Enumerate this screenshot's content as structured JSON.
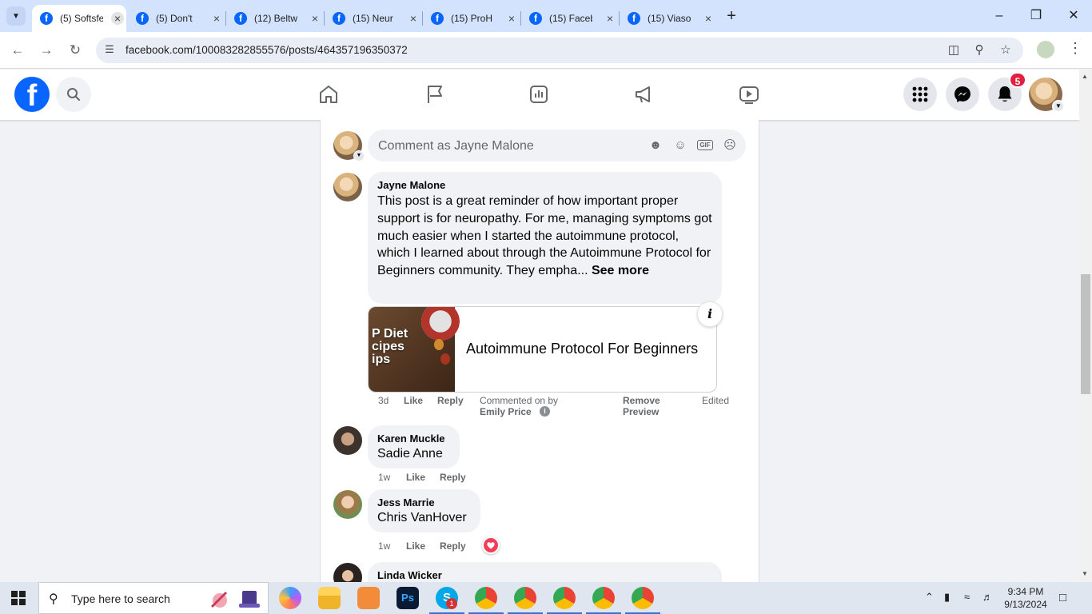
{
  "browser": {
    "tabs": [
      {
        "title": "(5) Softsfe",
        "active": true
      },
      {
        "title": "(5) Don't",
        "active": false
      },
      {
        "title": "(12) Beltw",
        "active": false
      },
      {
        "title": "(15) Neur",
        "active": false
      },
      {
        "title": "(15) ProH",
        "active": false
      },
      {
        "title": "(15) Faceb",
        "active": false
      },
      {
        "title": "(15) Viaso",
        "active": false
      }
    ],
    "url": "facebook.com/100083282855576/posts/464357196350372"
  },
  "fb_header": {
    "notification_count": "5",
    "colors": {
      "brand": "#0866ff",
      "badge": "#e41e3f"
    }
  },
  "composer": {
    "placeholder": "Comment as Jayne Malone"
  },
  "comments": [
    {
      "author": "Jayne Malone",
      "text": "This post is a great reminder of how important proper support is for neuropathy. For me, managing symptoms got much easier when I started the autoimmune protocol, which I learned about through the Autoimmune Protocol for Beginners community. They empha...",
      "see_more": "See more",
      "link_preview": {
        "image_text": "P Diet\ncipes\nips",
        "title": "Autoimmune Protocol For Beginners"
      },
      "time": "3d",
      "like": "Like",
      "reply": "Reply",
      "commented_on_by_label": "Commented on by",
      "commented_on_by_name": "Emily Price",
      "remove_preview_line1": "Remove",
      "remove_preview_line2": "Preview",
      "edited": "Edited"
    },
    {
      "author": "Karen Muckle",
      "tag": "Sadie Anne",
      "time": "1w",
      "like": "Like",
      "reply": "Reply"
    },
    {
      "author": "Jess Marrie",
      "tag": "Chris VanHover",
      "time": "1w",
      "like": "Like",
      "reply": "Reply",
      "reaction": "love"
    },
    {
      "author": "Linda Wicker"
    }
  ],
  "taskbar": {
    "search_placeholder": "Type here to search",
    "time": "9:34 PM",
    "date": "9/13/2024",
    "skype_badge": "1"
  }
}
